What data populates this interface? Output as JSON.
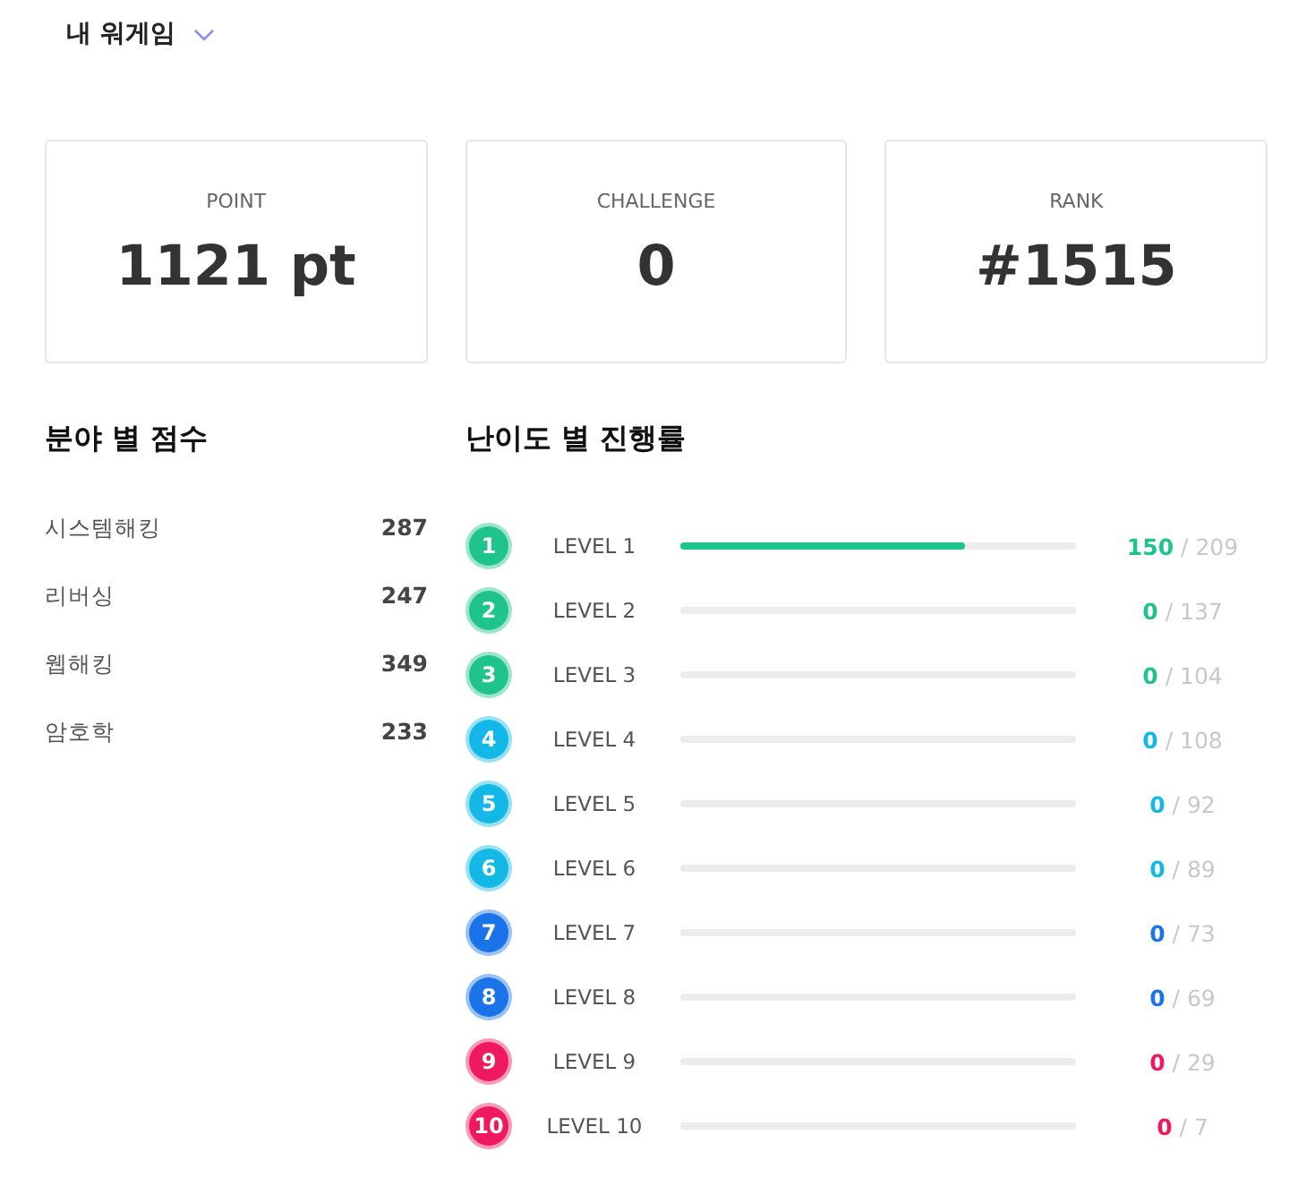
{
  "header": {
    "title": "내 워게임"
  },
  "stats": [
    {
      "label": "POINT",
      "value": "1121 pt"
    },
    {
      "label": "CHALLENGE",
      "value": "0"
    },
    {
      "label": "RANK",
      "value": "#1515"
    }
  ],
  "category_scores": {
    "title": "분야 별 점수",
    "items": [
      {
        "name": "시스템해킹",
        "score": "287"
      },
      {
        "name": "리버싱",
        "score": "247"
      },
      {
        "name": "웹해킹",
        "score": "349"
      },
      {
        "name": "암호학",
        "score": "233"
      }
    ]
  },
  "difficulty_progress": {
    "title": "난이도 별 진행률",
    "levels": [
      {
        "badge": "1",
        "label": "LEVEL 1",
        "level": 0.718,
        "solved": "150",
        "total": "/ 209",
        "color": "#1fc48d"
      },
      {
        "badge": "2",
        "label": "LEVEL 2",
        "level": 0,
        "solved": "0",
        "total": "/ 137",
        "color": "#1fc48d"
      },
      {
        "badge": "3",
        "label": "LEVEL 3",
        "level": 0,
        "solved": "0",
        "total": "/ 104",
        "color": "#1fc48d"
      },
      {
        "badge": "4",
        "label": "LEVEL 4",
        "level": 0,
        "solved": "0",
        "total": "/ 108",
        "color": "#14b8e6"
      },
      {
        "badge": "5",
        "label": "LEVEL 5",
        "level": 0,
        "solved": "0",
        "total": "/ 92",
        "color": "#14b8e6"
      },
      {
        "badge": "6",
        "label": "LEVEL 6",
        "level": 0,
        "solved": "0",
        "total": "/ 89",
        "color": "#14b8e6"
      },
      {
        "badge": "7",
        "label": "LEVEL 7",
        "level": 0,
        "solved": "0",
        "total": "/ 73",
        "color": "#1a73e8"
      },
      {
        "badge": "8",
        "label": "LEVEL 8",
        "level": 0,
        "solved": "0",
        "total": "/ 69",
        "color": "#1a73e8"
      },
      {
        "badge": "9",
        "label": "LEVEL 9",
        "level": 0,
        "solved": "0",
        "total": "/ 29",
        "color": "#f0185f"
      },
      {
        "badge": "10",
        "label": "LEVEL 10",
        "level": 0,
        "solved": "0",
        "total": "/ 7",
        "color": "#f0185f"
      }
    ]
  }
}
